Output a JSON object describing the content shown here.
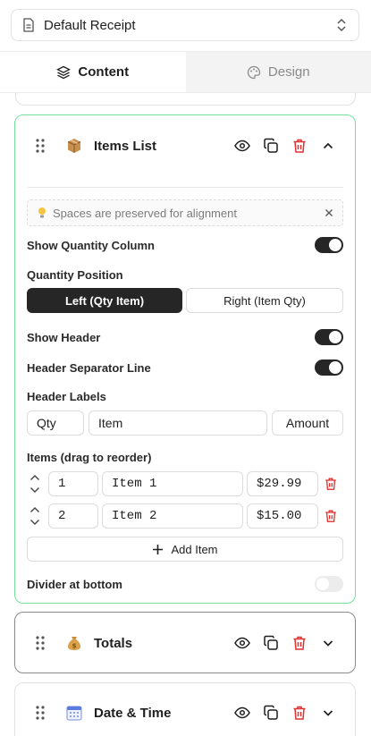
{
  "selector": {
    "value": "Default Receipt",
    "doc_icon": "document-icon",
    "chevron_icon": "chevron-up-down-icon"
  },
  "tabs": [
    {
      "label": "Content",
      "icon": "layers-icon",
      "active": true
    },
    {
      "label": "Design",
      "icon": "palette-icon",
      "active": false
    }
  ],
  "colors": {
    "active_border": "#74e29a",
    "danger": "#e03131",
    "toggle_on": "#262626",
    "toggle_off": "#ececec"
  },
  "items_card": {
    "emoji_icon": "package-icon",
    "title": "Items List",
    "tip": "Spaces are preserved for alignment",
    "show_quantity_label": "Show Quantity Column",
    "show_quantity": true,
    "quantity_position_label": "Quantity Position",
    "quantity_position_options": [
      "Left (Qty Item)",
      "Right (Item Qty)"
    ],
    "quantity_position_selected": "Left (Qty Item)",
    "show_header_label": "Show Header",
    "show_header": true,
    "header_separator_label": "Header Separator Line",
    "header_separator": true,
    "header_labels_label": "Header Labels",
    "header_labels": {
      "qty": "Qty",
      "item": "Item",
      "amount": "Amount"
    },
    "items_label": "Items (drag to reorder)",
    "items": [
      {
        "qty": "1",
        "name": "Item 1",
        "price": "$29.99"
      },
      {
        "qty": "2",
        "name": "Item 2",
        "price": "$15.00"
      }
    ],
    "add_item_label": "Add Item",
    "divider_label": "Divider at bottom",
    "divider": false
  },
  "totals_card": {
    "emoji_icon": "money-bag-icon",
    "title": "Totals"
  },
  "date_card": {
    "emoji_icon": "calendar-icon",
    "title": "Date & Time"
  }
}
